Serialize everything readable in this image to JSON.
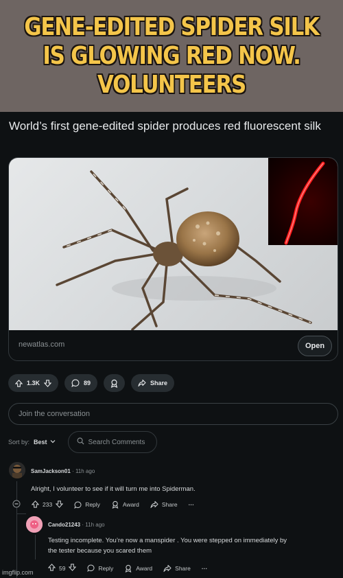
{
  "meme": {
    "caption": "GENE-EDITED SPIDER SILK IS GLOWING RED NOW. VOLUNTEERS"
  },
  "post": {
    "title": "World’s first gene-edited spider produces red fluorescent silk",
    "link": {
      "domain": "newatlas.com",
      "open_label": "Open"
    },
    "actions": {
      "votes": "1.3K",
      "comments": "89",
      "share_label": "Share"
    },
    "comment_placeholder": "Join the conversation",
    "sort": {
      "label": "Sort by:",
      "value": "Best",
      "search_placeholder": "Search Comments"
    }
  },
  "comments": [
    {
      "user": "SamJackson01",
      "time": "11h ago",
      "body": "Alright, I volunteer to see if it will turn me into Spiderman.",
      "votes": "233",
      "reply_label": "Reply",
      "award_label": "Award",
      "share_label": "Share",
      "more": "···"
    },
    {
      "user": "Cando21243",
      "time": "11h ago",
      "body_line1": "Testing incomplete. You’re now a manspider . You were stepped on immediately by",
      "body_line2": "the tester because you scared them",
      "votes": "59",
      "reply_label": "Reply",
      "award_label": "Award",
      "share_label": "Share",
      "more": "···"
    }
  ],
  "watermark": "imgflip.com",
  "colors": {
    "caption_text": "#f4c54a",
    "caption_bg": "#6e6562",
    "page_bg": "#0e1113",
    "pill_bg": "#272d31",
    "silk_red": "#ff1a1a"
  }
}
